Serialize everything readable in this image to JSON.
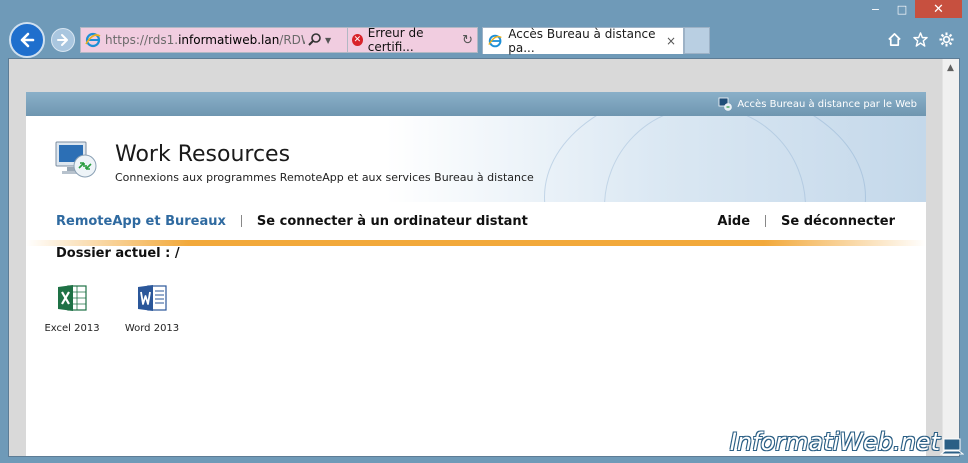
{
  "browser": {
    "address": {
      "scheme": "https://rds1.",
      "host": "informatiweb.lan",
      "path": "/RDWeb/I"
    },
    "cert_error": "Erreur de certifi...",
    "tab_title": "Accès Bureau à distance pa...",
    "tab_close": "×",
    "window": {
      "minimize": "−",
      "maximize": "□",
      "close": "✕"
    }
  },
  "rdweb": {
    "top_bar_label": "Accès Bureau à distance par le Web",
    "title": "Work Resources",
    "subtitle": "Connexions aux programmes RemoteApp et aux services Bureau à distance",
    "nav": {
      "remoteapp": "RemoteApp et Bureaux",
      "connect": "Se connecter à un ordinateur distant",
      "help": "Aide",
      "logout": "Se déconnecter"
    },
    "current_folder": "Dossier actuel : /",
    "apps": [
      {
        "label": "Excel 2013",
        "icon": "excel-icon"
      },
      {
        "label": "Word 2013",
        "icon": "word-icon"
      }
    ]
  },
  "watermark": "InformatiWeb.net",
  "colors": {
    "accent": "#2f6aa0",
    "orange": "#f2a93b",
    "chrome": "#6f9ab8",
    "cert_bg": "#f1cde0"
  }
}
